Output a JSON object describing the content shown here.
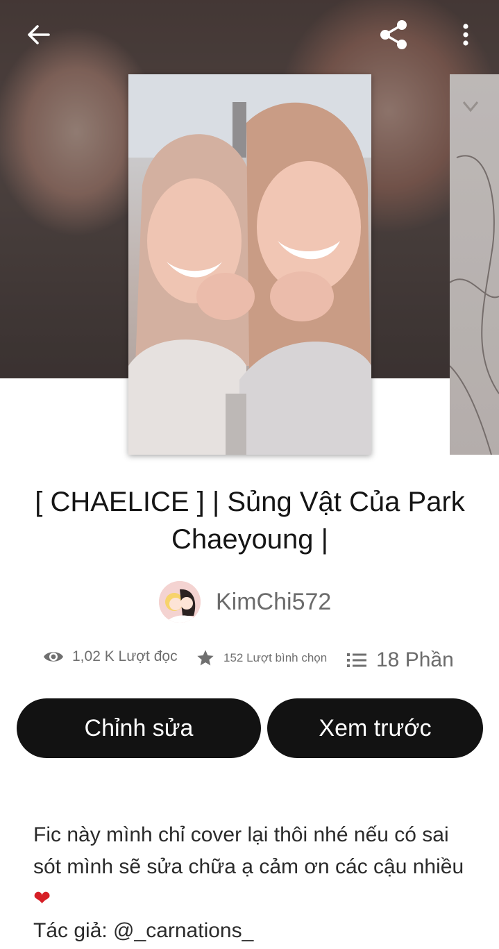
{
  "header": {
    "back_icon": "arrow-left-icon",
    "share_icon": "share-icon",
    "more_icon": "more-vertical-icon"
  },
  "story": {
    "title": "[ CHAELICE ] | Sủng Vật Của Park Chaeyoung |",
    "author": "KimChi572"
  },
  "stats": {
    "reads": "1,02 K Lượt đọc",
    "votes": "152 Lượt bình chọn",
    "parts": "18 Phần"
  },
  "actions": {
    "edit_label": "Chỉnh sửa",
    "preview_label": "Xem trước"
  },
  "description": {
    "line1": "Fic này mình chỉ cover lại thôi nhé nếu có sai sót mình sẽ sửa chữa ạ cảm ơn các cậu nhiều",
    "heart": "❤",
    "line2": "Tác giả: @_carnations_"
  },
  "colors": {
    "button_bg": "#121212",
    "heart": "#d61f26"
  }
}
